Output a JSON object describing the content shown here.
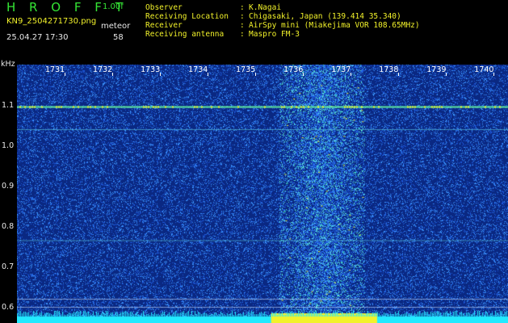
{
  "header": {
    "app_title": "H R O F F T",
    "version": "1.00f",
    "filename": "KN9_2504271730.png",
    "meteor_label": "meteor",
    "datetime": "25.04.27 17:30",
    "meteor_count": "58"
  },
  "info": {
    "observer_label": "Observer",
    "observer_value": "K.Nagai",
    "location_label": "Receiving Location",
    "location_value": "Chigasaki, Japan (139.414 35.340)",
    "receiver_label": "Receiver",
    "receiver_value": "AirSpy mini (Miakejima VOR 108.65MHz)",
    "antenna_label": "Receiving antenna",
    "antenna_value": "Maspro FM-3",
    "separator": ":"
  },
  "chart_data": {
    "type": "heatmap",
    "ylabel": "kHz",
    "yticks": [
      "1.1",
      "1.0",
      "0.9",
      "0.8",
      "0.7",
      "0.6"
    ],
    "xticks": [
      "1731",
      "1732",
      "1733",
      "1734",
      "1735",
      "1736",
      "1737",
      "1738",
      "1739",
      "1740"
    ],
    "ylim": [
      0.6,
      1.2
    ],
    "xlim": [
      1730.0,
      1740.3
    ],
    "carrier_khz": 1.097,
    "burst_range": [
      1735.5,
      1737.3
    ],
    "colors": {
      "background": "#0a2a82",
      "noise": "#3a8cff",
      "signal": "#f2f22a",
      "floor": "#22eaff"
    }
  }
}
